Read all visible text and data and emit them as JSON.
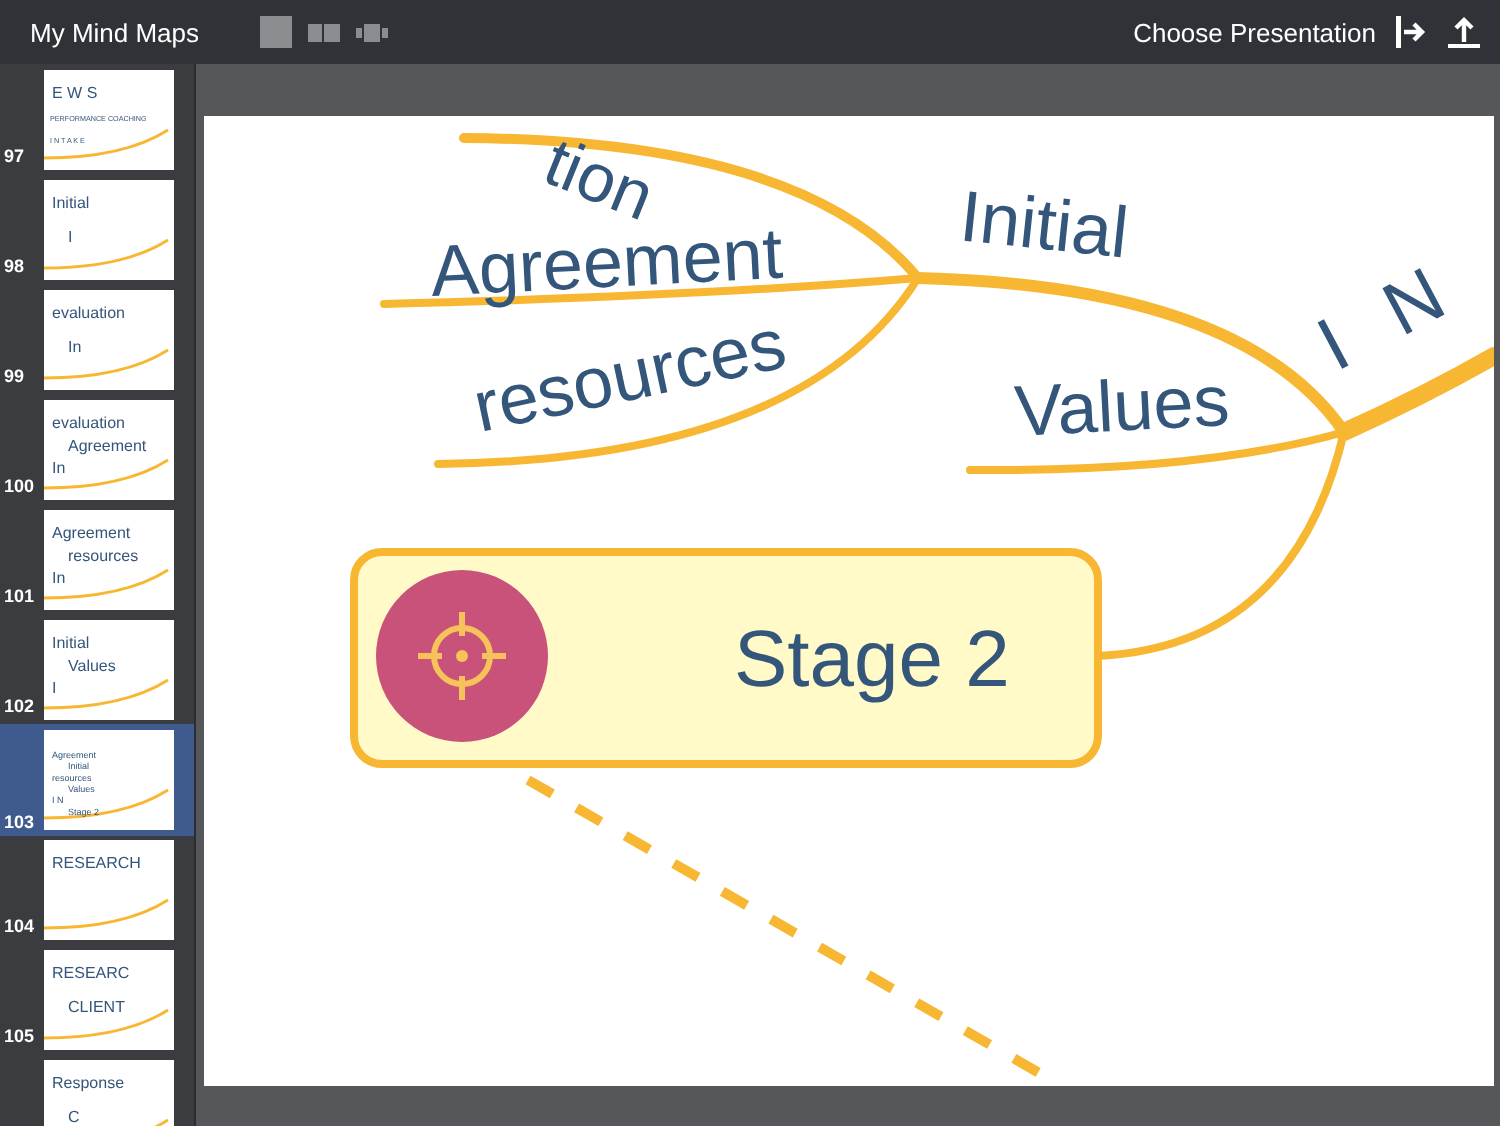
{
  "header": {
    "title": "My Mind Maps",
    "presentation_button": "Choose Presentation"
  },
  "slides": [
    {
      "number": "97",
      "selected": false,
      "labels": [
        "E W S",
        "PERFORMANCE COACHING",
        "I N T A K E"
      ]
    },
    {
      "number": "98",
      "selected": false,
      "labels": [
        "Initial",
        "I"
      ]
    },
    {
      "number": "99",
      "selected": false,
      "labels": [
        "evaluation",
        "In"
      ]
    },
    {
      "number": "100",
      "selected": false,
      "labels": [
        "evaluation",
        "Agreement",
        "In"
      ]
    },
    {
      "number": "101",
      "selected": false,
      "labels": [
        "Agreement",
        "resources",
        "In"
      ]
    },
    {
      "number": "102",
      "selected": false,
      "labels": [
        "Initial",
        "Values",
        "I"
      ]
    },
    {
      "number": "103",
      "selected": true,
      "labels": [
        "Agreement",
        "Initial",
        "resources",
        "Values",
        "I N",
        "Stage 2"
      ]
    },
    {
      "number": "104",
      "selected": false,
      "labels": [
        "RESEARCH"
      ]
    },
    {
      "number": "105",
      "selected": false,
      "labels": [
        "RESEARC",
        "CLIENT"
      ]
    },
    {
      "selected": false,
      "labels": [
        "Response",
        "C"
      ]
    }
  ],
  "canvas": {
    "branch_labels": [
      "tion",
      "Agreement",
      "Initial",
      "resources",
      "Values",
      "I N"
    ],
    "stage": {
      "label": "Stage 2"
    }
  }
}
